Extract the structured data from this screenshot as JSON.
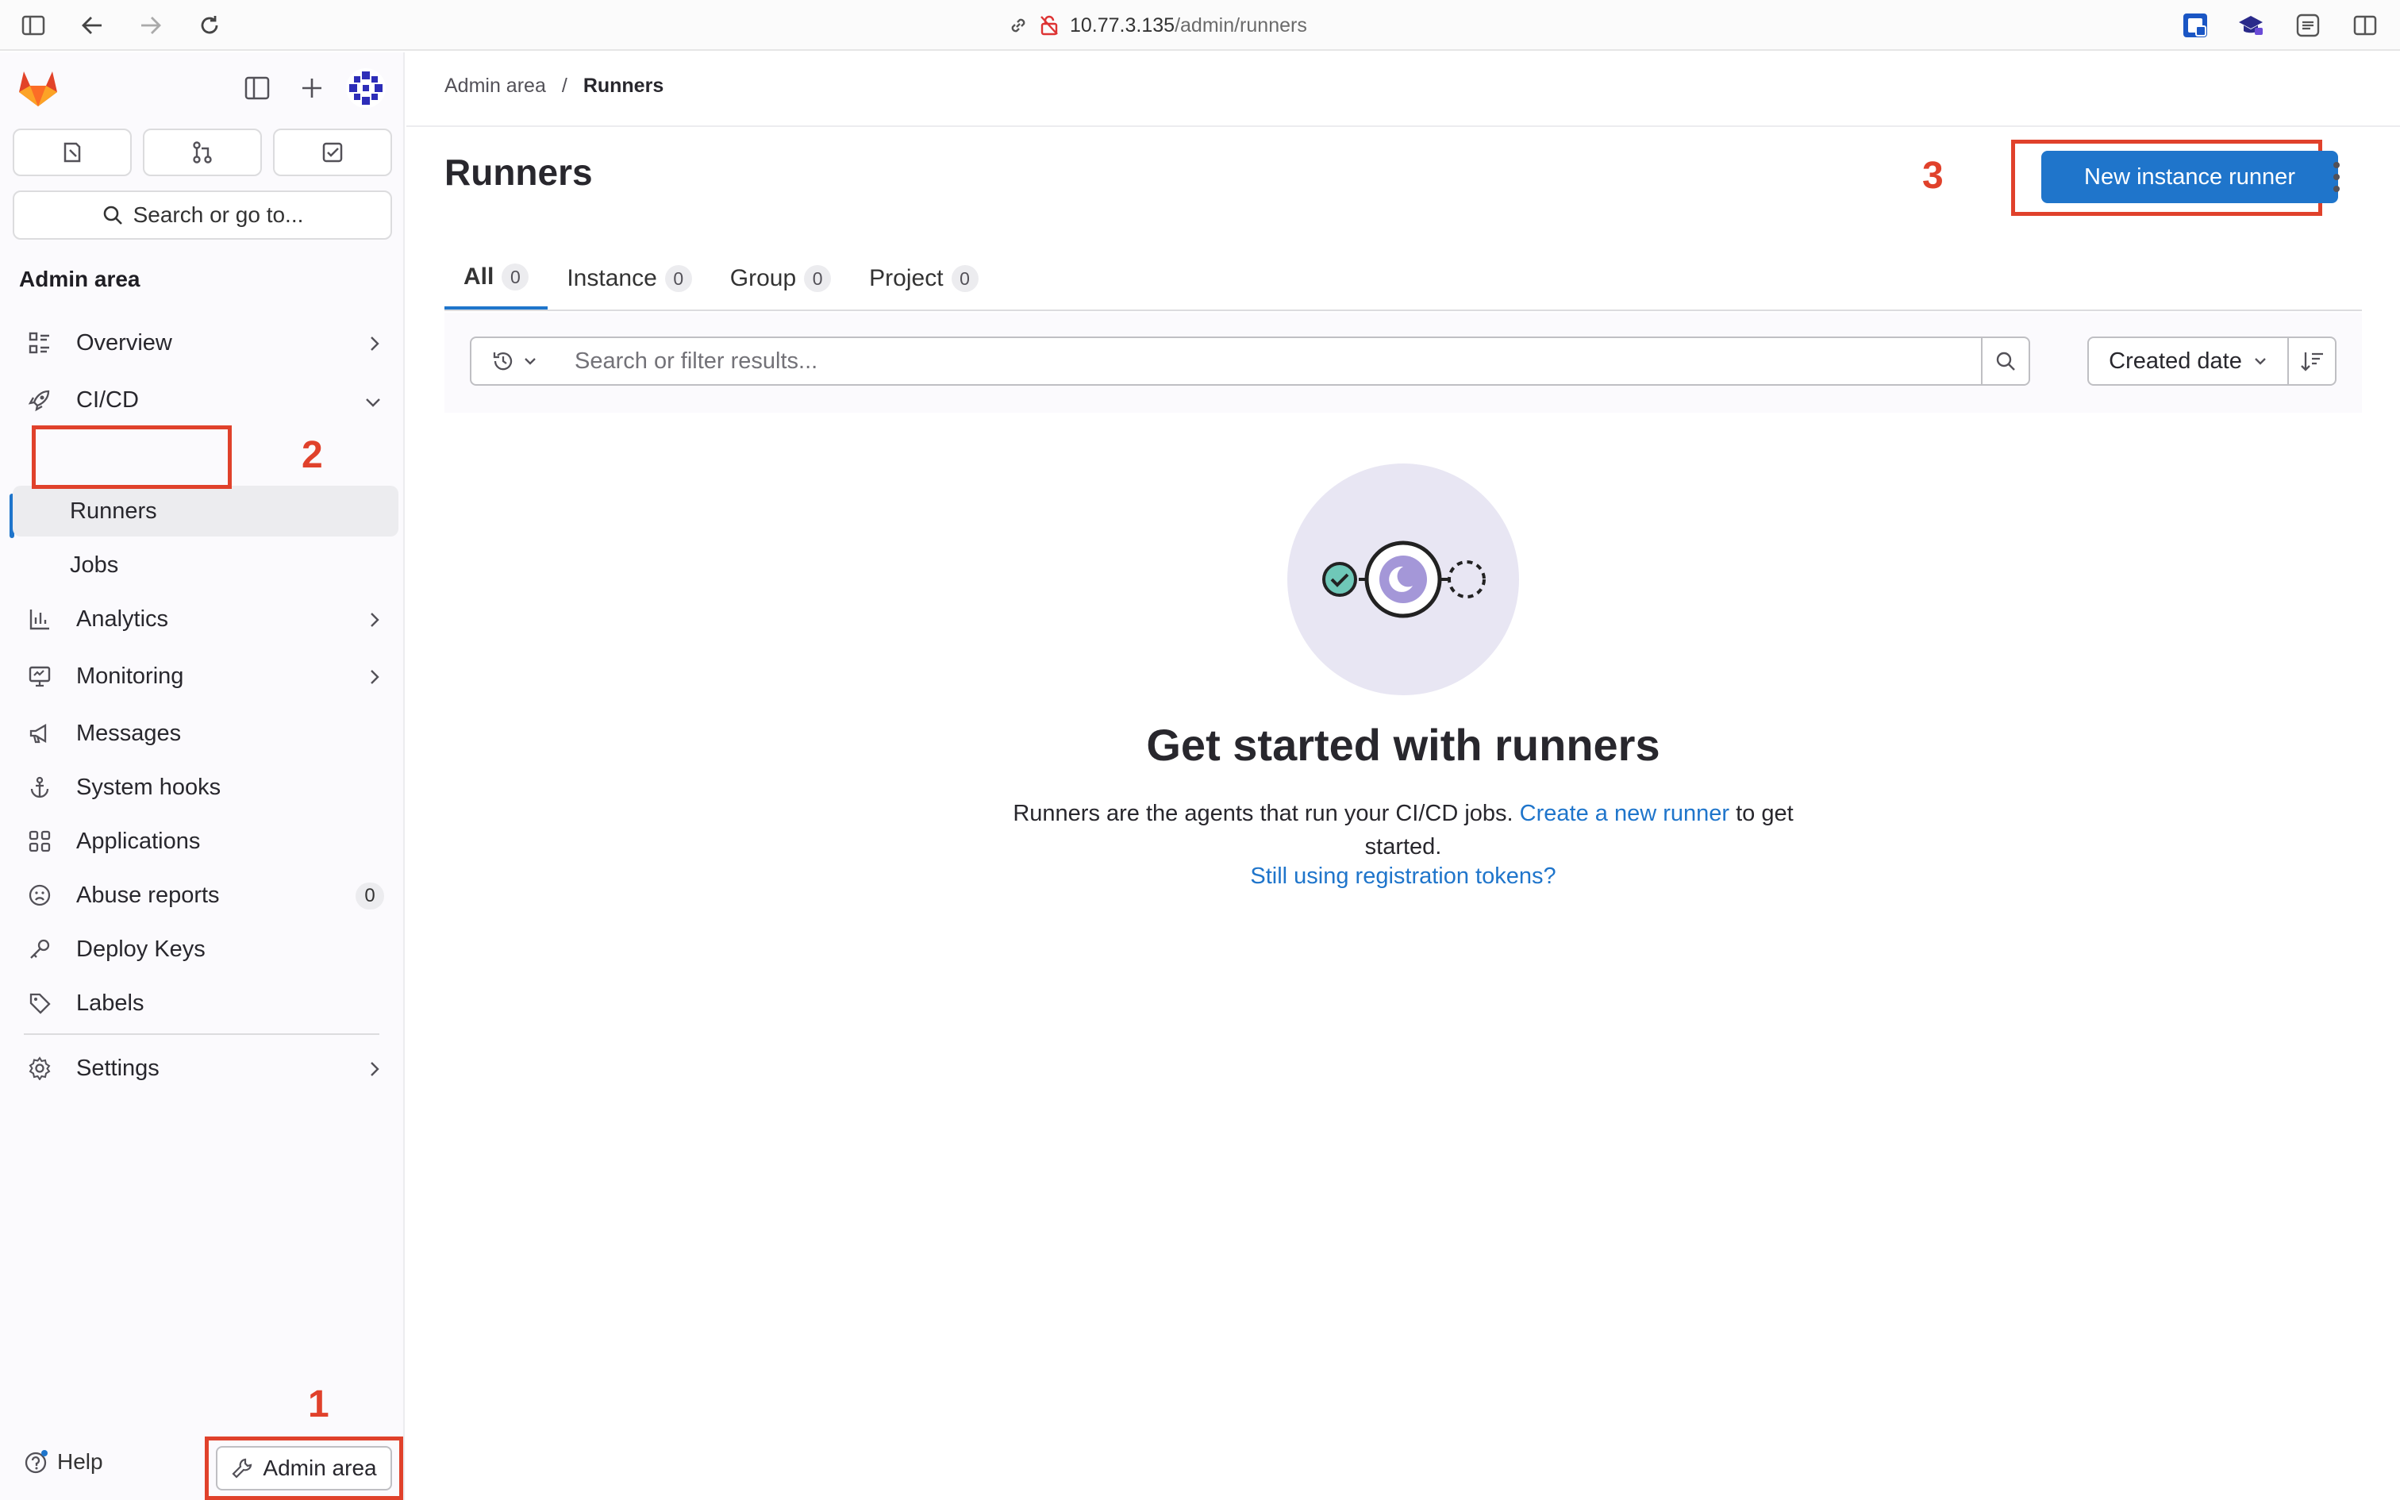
{
  "browser": {
    "url_host": "10.77.3.135",
    "url_path": "/admin/runners"
  },
  "sidebar": {
    "search_label": "Search or go to...",
    "section_title": "Admin area",
    "items": [
      {
        "label": "Overview"
      },
      {
        "label": "CI/CD"
      },
      {
        "label": "Runners"
      },
      {
        "label": "Jobs"
      },
      {
        "label": "Analytics"
      },
      {
        "label": "Monitoring"
      },
      {
        "label": "Messages"
      },
      {
        "label": "System hooks"
      },
      {
        "label": "Applications"
      },
      {
        "label": "Abuse reports",
        "badge": "0"
      },
      {
        "label": "Deploy Keys"
      },
      {
        "label": "Labels"
      },
      {
        "label": "Settings"
      }
    ],
    "help_label": "Help",
    "admin_area_label": "Admin area"
  },
  "breadcrumb": {
    "parent": "Admin area",
    "separator": "/",
    "current": "Runners"
  },
  "main": {
    "title": "Runners",
    "new_runner_label": "New instance runner",
    "tabs": [
      {
        "label": "All",
        "count": "0"
      },
      {
        "label": "Instance",
        "count": "0"
      },
      {
        "label": "Group",
        "count": "0"
      },
      {
        "label": "Project",
        "count": "0"
      }
    ],
    "filter_placeholder": "Search or filter results...",
    "sort_label": "Created date",
    "empty": {
      "title": "Get started with runners",
      "text_before": "Runners are the agents that run your CI/CD jobs.",
      "link": "Create a new runner",
      "text_after": "to get started.",
      "link2": "Still using registration tokens?"
    }
  },
  "annotations": [
    "1",
    "2",
    "3"
  ],
  "colors": {
    "accent": "#1f75cb",
    "annotation": "#e0412b"
  }
}
